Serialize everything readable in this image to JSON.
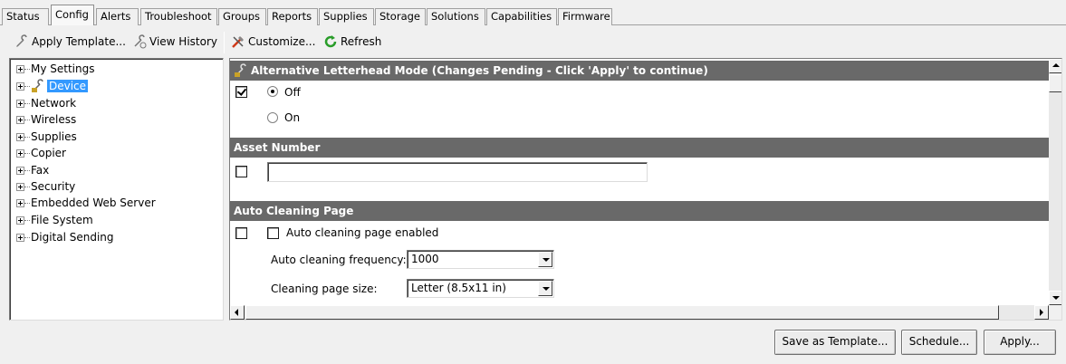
{
  "tabs": [
    "Status",
    "Config",
    "Alerts",
    "Troubleshoot",
    "Groups",
    "Reports",
    "Supplies",
    "Storage",
    "Solutions",
    "Capabilities",
    "Firmware"
  ],
  "active_tab": "Config",
  "toolbar": {
    "apply_template": "Apply Template...",
    "view_history": "View History",
    "customize": "Customize...",
    "refresh": "Refresh"
  },
  "tree": {
    "items": [
      "My Settings",
      "Device",
      "Network",
      "Wireless",
      "Supplies",
      "Copier",
      "Fax",
      "Security",
      "Embedded Web Server",
      "File System",
      "Digital Sending"
    ],
    "selected": "Device"
  },
  "sections": {
    "letterhead": {
      "title": "Alternative Letterhead Mode (Changes Pending - Click 'Apply' to continue)",
      "checked": true,
      "option_off": "Off",
      "option_on": "On",
      "selected": "Off"
    },
    "asset": {
      "title": "Asset Number",
      "value": "",
      "checked": false
    },
    "cleaning": {
      "title": "Auto Cleaning Page",
      "enabled_label": "Auto cleaning page enabled",
      "enabled": false,
      "frequency_label": "Auto cleaning frequency:",
      "frequency_value": "1000",
      "size_label": "Cleaning page size:",
      "size_value": "Letter (8.5x11 in)"
    }
  },
  "buttons": {
    "save_template": "Save as Template...",
    "schedule": "Schedule...",
    "apply": "Apply..."
  },
  "colors": {
    "section_header": "#696969",
    "selection": "#3399ff",
    "refresh_icon": "#2a9d2a",
    "customize_icon": "#d03a1a"
  }
}
